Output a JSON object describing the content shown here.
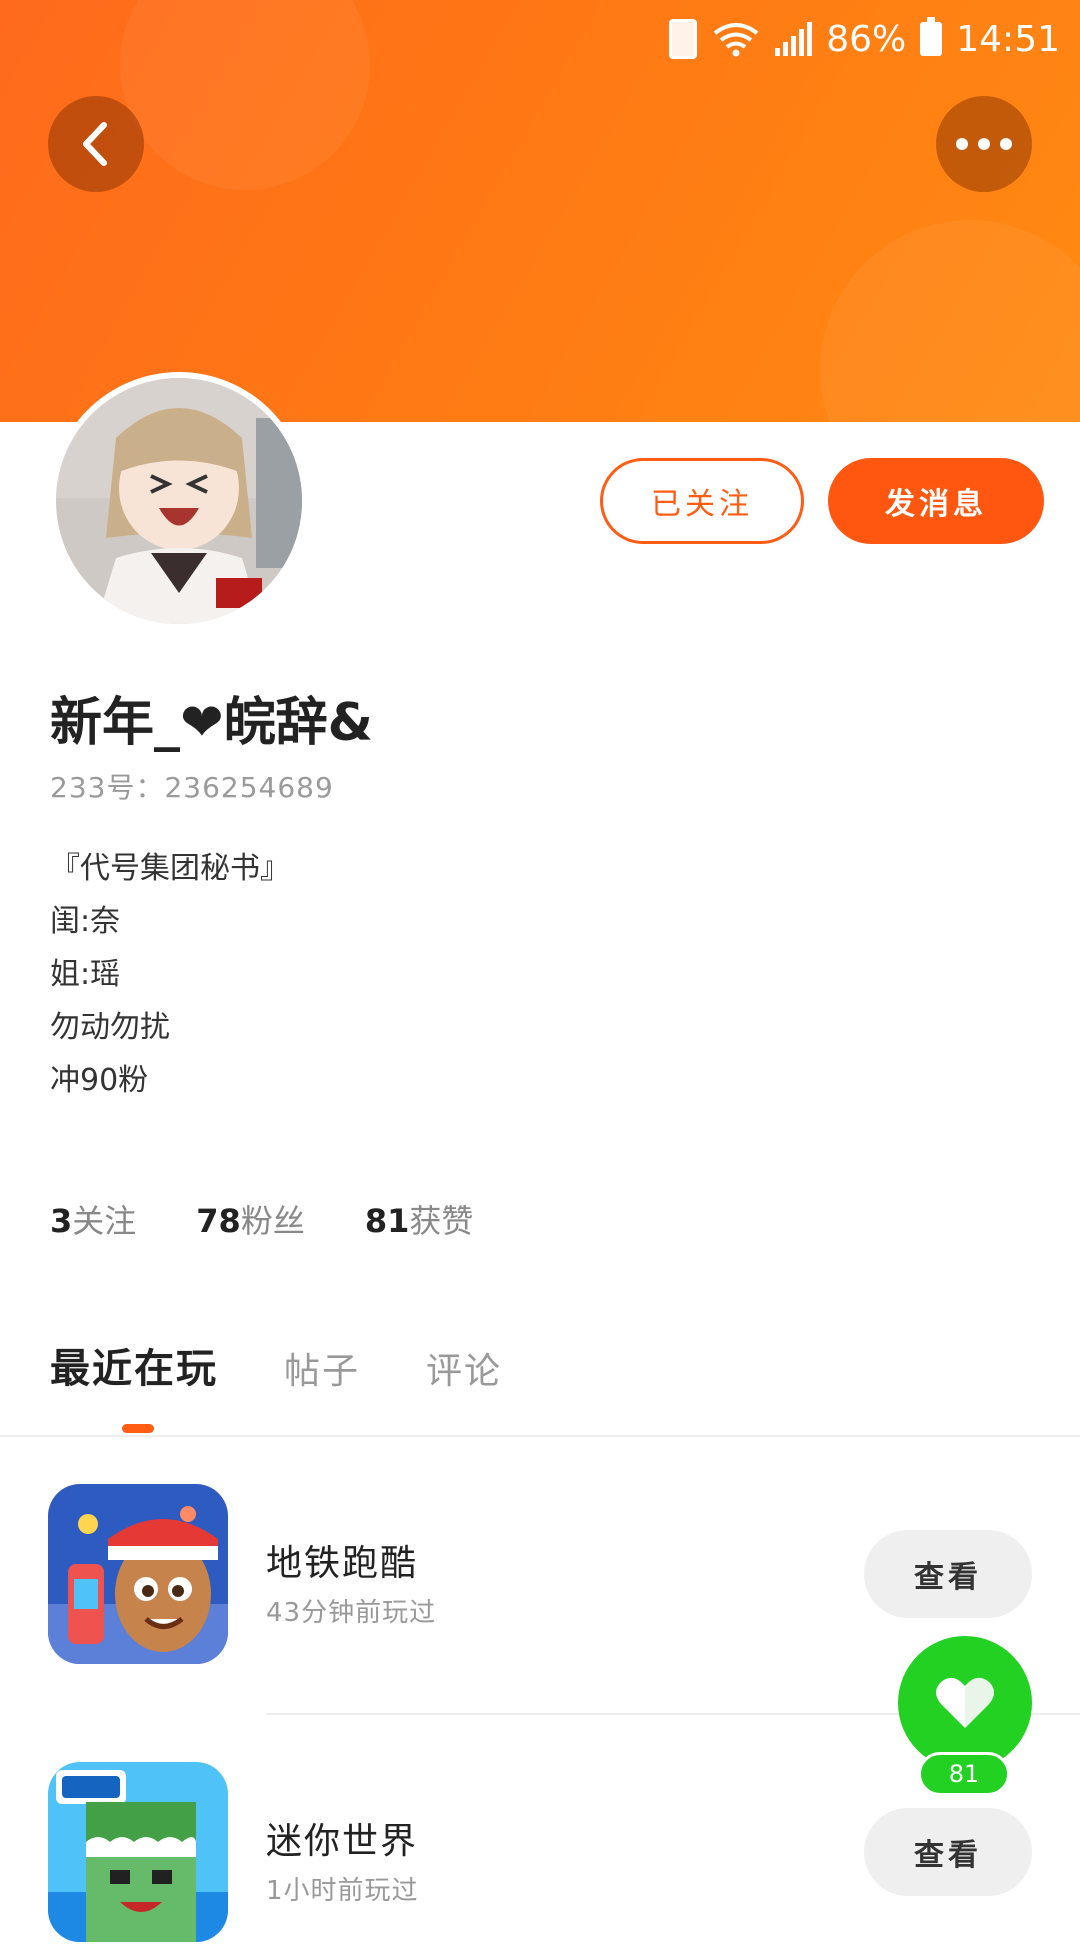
{
  "status_bar": {
    "battery_percent": "86%",
    "time": "14:51"
  },
  "profile": {
    "name": "新年_❤皖辞&",
    "id_text": "233号：236254689",
    "follow_state_label": "已关注",
    "message_label": "发消息",
    "bio_lines": [
      "『代号集团秘书』",
      "闺:奈",
      "姐:瑶",
      "勿动勿扰",
      "冲90粉"
    ]
  },
  "stats": {
    "following": {
      "value": "3",
      "label": "关注"
    },
    "fans": {
      "value": "78",
      "label": "粉丝"
    },
    "likes": {
      "value": "81",
      "label": "获赞"
    }
  },
  "tabs": [
    {
      "label": "最近在玩",
      "active": true
    },
    {
      "label": "帖子",
      "active": false
    },
    {
      "label": "评论",
      "active": false
    }
  ],
  "games": [
    {
      "name": "地铁跑酷",
      "time": "43分钟前玩过",
      "button": "查看",
      "icon": "subway-surfers-icon"
    },
    {
      "name": "迷你世界",
      "time": "1小时前玩过",
      "button": "查看",
      "icon": "mini-world-icon"
    }
  ],
  "like_fab": {
    "count": "81",
    "icon": "heart-icon"
  },
  "colors": {
    "accent": "#ff5c14",
    "header": "#ff7a14",
    "like_green": "#22d122"
  }
}
